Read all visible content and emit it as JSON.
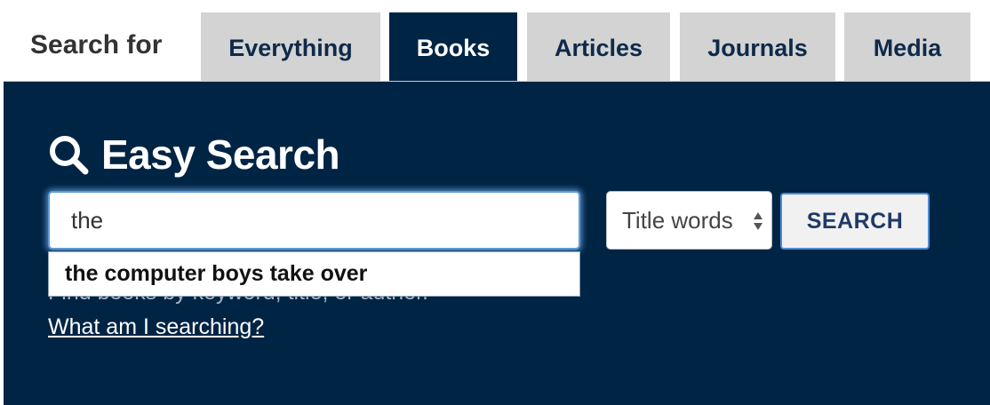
{
  "tabs": {
    "label": "Search for",
    "items": [
      {
        "label": "Everything",
        "active": false
      },
      {
        "label": "Books",
        "active": true
      },
      {
        "label": "Articles",
        "active": false
      },
      {
        "label": "Journals",
        "active": false
      },
      {
        "label": "Media",
        "active": false
      }
    ]
  },
  "panel": {
    "title": "Easy Search",
    "title_icon": "search-icon",
    "search": {
      "value": "the",
      "placeholder": ""
    },
    "field_select": {
      "selected": "Title words",
      "icon": "sort-arrows-icon"
    },
    "search_button_label": "SEARCH",
    "helper_text": "Find books by keyword, title, or author.",
    "help_link": "What am I searching?",
    "autocomplete": {
      "suggestions": [
        "the computer boys take over"
      ]
    }
  },
  "colors": {
    "panel_bg": "#002444",
    "tab_bg": "#d3d3d3",
    "tab_text": "#0d2a4a",
    "focus_ring": "#5d9bd6"
  }
}
